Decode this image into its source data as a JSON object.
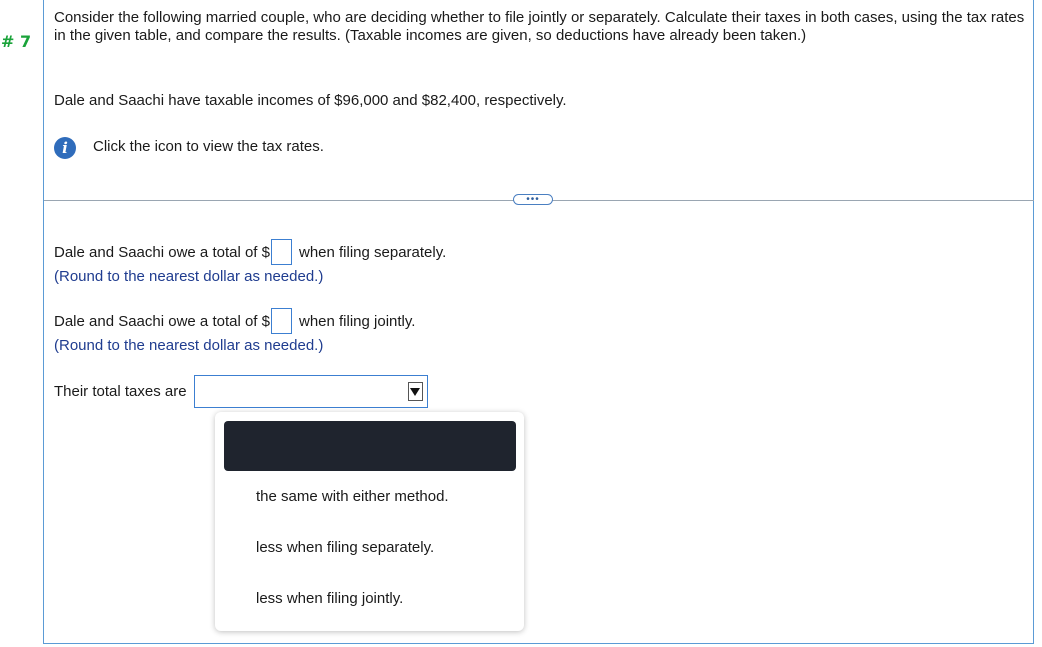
{
  "question_number": "# 7",
  "question": {
    "prompt": "Consider the following married couple, who are deciding whether to file jointly or separately. Calculate their taxes in both cases, using the tax rates in the given table, and compare the results. (Taxable incomes are given, so deductions have already been taken.)",
    "given": "Dale and Saachi have taxable incomes of $96,000 and $82,400, respectively.",
    "info_text": "Click the icon to view the tax rates."
  },
  "icons": {
    "info": "info-icon",
    "expand": "ellipsis-icon",
    "dropdown_arrow": "chevron-down-icon"
  },
  "answers": {
    "separate_prefix": "Dale and Saachi owe a total of $",
    "separate_suffix": "when filing separately.",
    "separate_value": "",
    "separate_hint": "(Round to the nearest dollar as needed.)",
    "joint_prefix": "Dale and Saachi owe a total of $",
    "joint_suffix": "when filing jointly.",
    "joint_value": "",
    "joint_hint": "(Round to the nearest dollar as needed.)"
  },
  "comparison": {
    "label": "Their total taxes are",
    "selected": "",
    "options": [
      "the same with either method.",
      "less when filing separately.",
      "less when filing jointly."
    ]
  },
  "colors": {
    "accent_green": "#1aa33a",
    "border_blue": "#5b9bd5",
    "hint_blue": "#1f3c8f",
    "selected_option": "#1f242e"
  }
}
